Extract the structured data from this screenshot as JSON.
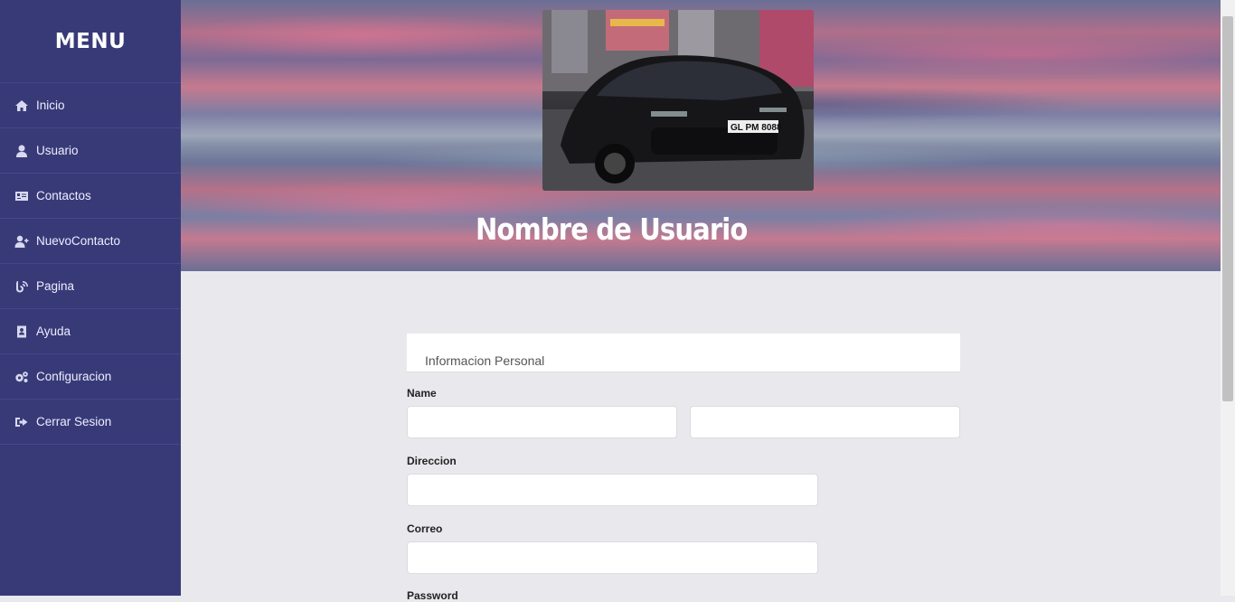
{
  "sidebar": {
    "title": "MENU",
    "items": [
      {
        "label": "Inicio",
        "icon": "home-icon"
      },
      {
        "label": "Usuario",
        "icon": "user-icon"
      },
      {
        "label": "Contactos",
        "icon": "address-card-icon"
      },
      {
        "label": "NuevoContacto",
        "icon": "user-plus-icon"
      },
      {
        "label": "Pagina",
        "icon": "blog-icon"
      },
      {
        "label": "Ayuda",
        "icon": "address-book-icon"
      },
      {
        "label": "Configuracion",
        "icon": "cogs-icon"
      },
      {
        "label": "Cerrar Sesion",
        "icon": "sign-out-icon"
      }
    ]
  },
  "hero": {
    "username": "Nombre de Usuario",
    "plate_text": "GL PM 8088"
  },
  "form": {
    "section_title": "Informacion Personal",
    "name_label": "Name",
    "first_name_value": "",
    "last_name_value": "",
    "direccion_label": "Direccion",
    "direccion_value": "",
    "correo_label": "Correo",
    "correo_value": "",
    "password_label": "Password"
  },
  "colors": {
    "sidebar": "#383a78",
    "content_bg": "#e9e8ec"
  }
}
